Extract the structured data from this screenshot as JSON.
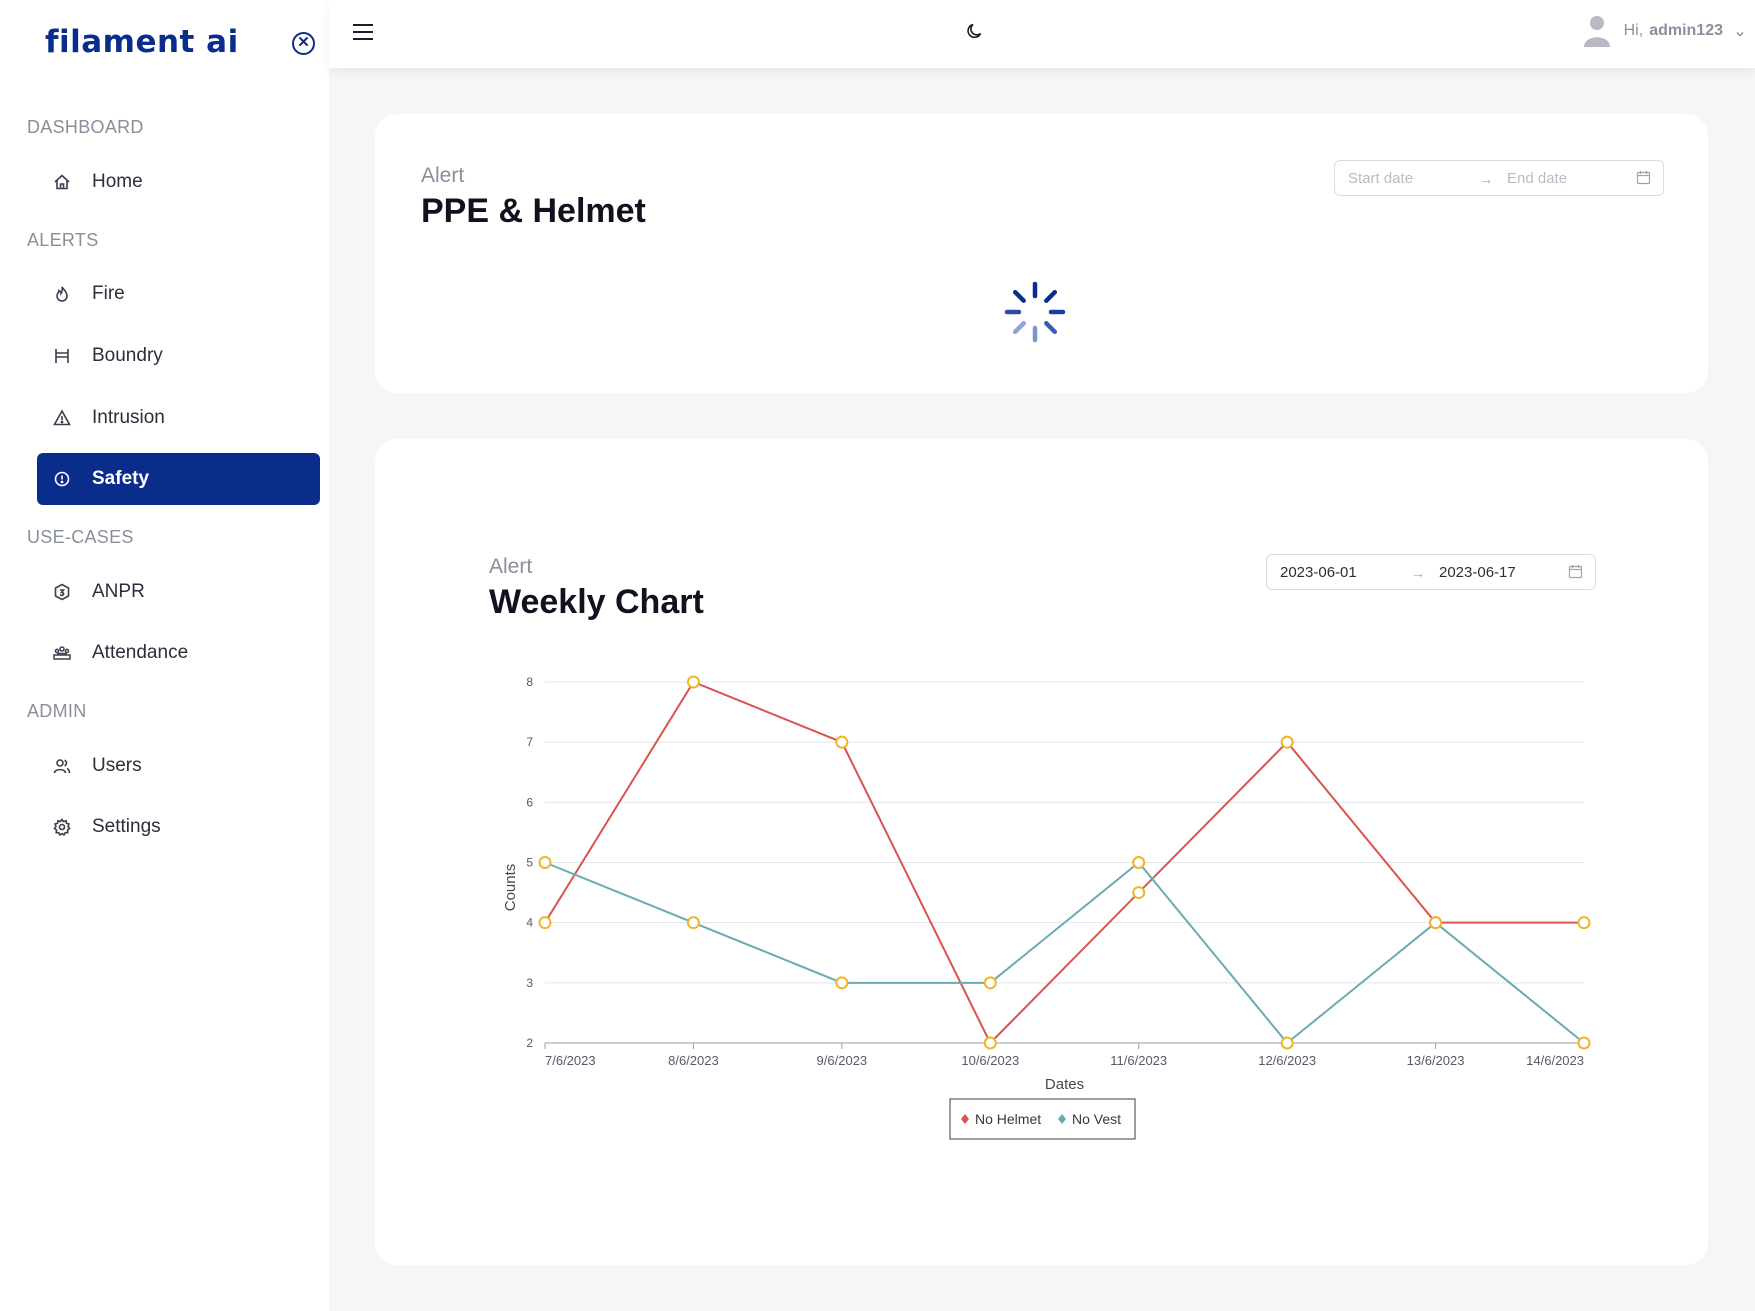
{
  "sidebar": {
    "brand": "filament ai",
    "close_icon": "close-circle-icon",
    "sections": [
      {
        "title": "DASHBOARD",
        "items": [
          {
            "label": "Home",
            "icon": "home-icon"
          }
        ]
      },
      {
        "title": "ALERTS",
        "items": [
          {
            "label": "Fire",
            "icon": "fire-icon"
          },
          {
            "label": "Boundry",
            "icon": "barrier-icon"
          },
          {
            "label": "Intrusion",
            "icon": "warning-icon"
          },
          {
            "label": "Safety",
            "icon": "alert-circle-icon",
            "active": true
          }
        ]
      },
      {
        "title": "USE-CASES",
        "items": [
          {
            "label": "ANPR",
            "icon": "badge-icon"
          },
          {
            "label": "Attendance",
            "icon": "team-icon"
          }
        ]
      },
      {
        "title": "ADMIN",
        "items": [
          {
            "label": "Users",
            "icon": "users-icon"
          },
          {
            "label": "Settings",
            "icon": "gear-icon"
          }
        ]
      }
    ],
    "accent": "#0a2d8c"
  },
  "topbar": {
    "menu_icon": "hamburger-icon",
    "theme_icon": "moon-icon",
    "greeting": "Hi,",
    "username": "admin123"
  },
  "ppe_card": {
    "subtitle": "Alert",
    "title": "PPE & Helmet",
    "start_placeholder": "Start date",
    "end_placeholder": "End date",
    "loading": true
  },
  "weekly_card": {
    "subtitle": "Alert",
    "title": "Weekly Chart",
    "start_value": "2023-06-01",
    "end_value": "2023-06-17"
  },
  "chart_data": {
    "type": "line",
    "x": [
      "7/6/2023",
      "8/6/2023",
      "9/6/2023",
      "10/6/2023",
      "11/6/2023",
      "12/6/2023",
      "13/6/2023",
      "14/6/2023"
    ],
    "xlabel": "Dates",
    "ylabel": "Counts",
    "ylim": [
      2,
      8
    ],
    "yticks": [
      2,
      3,
      4,
      5,
      6,
      7,
      8
    ],
    "grid": true,
    "legend_position": "bottom-center",
    "series": [
      {
        "name": "No Helmet",
        "color": "#d9534f",
        "values": [
          4,
          8,
          7,
          2,
          4.5,
          7,
          4,
          4
        ]
      },
      {
        "name": "No Vest",
        "color": "#6aabb3",
        "values": [
          5,
          4,
          3,
          3,
          5,
          2,
          4,
          2
        ]
      }
    ],
    "marker_color": "#f0b429"
  }
}
